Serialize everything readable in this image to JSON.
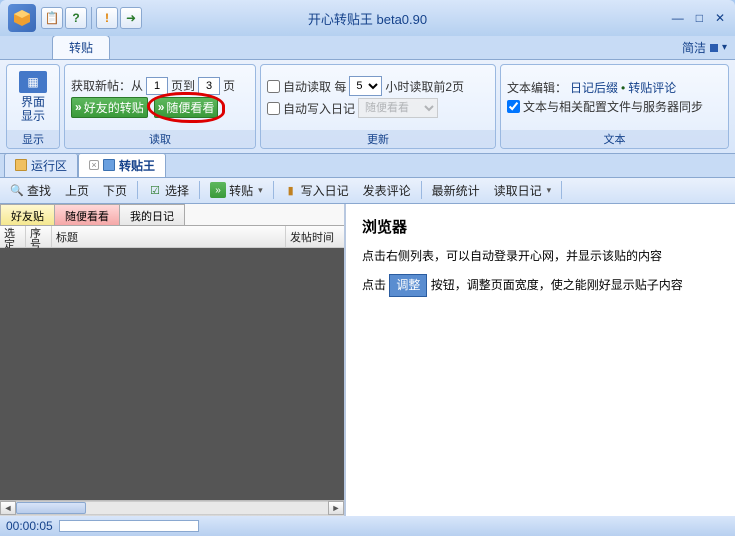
{
  "app": {
    "title": "开心转贴王  beta0.90"
  },
  "titlebar": {
    "icons": [
      "app",
      "clipboard",
      "help",
      "warn",
      "exit"
    ]
  },
  "mainTab": {
    "label": "转贴"
  },
  "rightToggle": {
    "label": "简洁"
  },
  "ribbon": {
    "display": {
      "btn": "界面\n显示",
      "group": "显示"
    },
    "read": {
      "line1_pre": "获取新帖：从",
      "from": "1",
      "mid": "页到",
      "to": "3",
      "suf": "页",
      "friends": "好友的转贴",
      "random": "随便看看",
      "group": "读取"
    },
    "update": {
      "autoread": "自动读取 每",
      "interval": "5",
      "interval_suf": "小时读取前2页",
      "autowrite": "自动写入日记",
      "combo": "随便看看",
      "group": "更新"
    },
    "text": {
      "line1a": "文本编辑：",
      "line1b": "日记后缀",
      "line1c": "转贴评论",
      "chk": "文本与相关配置文件与服务器同步",
      "group": "文本"
    }
  },
  "docTabs": {
    "run": "运行区",
    "main": "转贴王"
  },
  "toolbar": {
    "find": "查找",
    "prev": "上页",
    "next": "下页",
    "select": "选择",
    "repost": "转贴",
    "diary": "写入日记",
    "comment": "发表评论",
    "stats": "最新统计",
    "readdiary": "读取日记"
  },
  "innerTabs": {
    "a": "好友贴",
    "b": "随便看看",
    "c": "我的日记"
  },
  "listCols": {
    "sel": "选\n定",
    "num": "序\n号",
    "title": "标题",
    "time": "发帖时间"
  },
  "browser": {
    "heading": "浏览器",
    "p1": "点击右侧列表，可以自动登录开心网，并显示该贴的内容",
    "p2a": "点击",
    "adjust": "调整",
    "p2b": "按钮，调整页面宽度，使之能刚好显示贴子内容"
  },
  "status": {
    "time": "00:00:05"
  }
}
